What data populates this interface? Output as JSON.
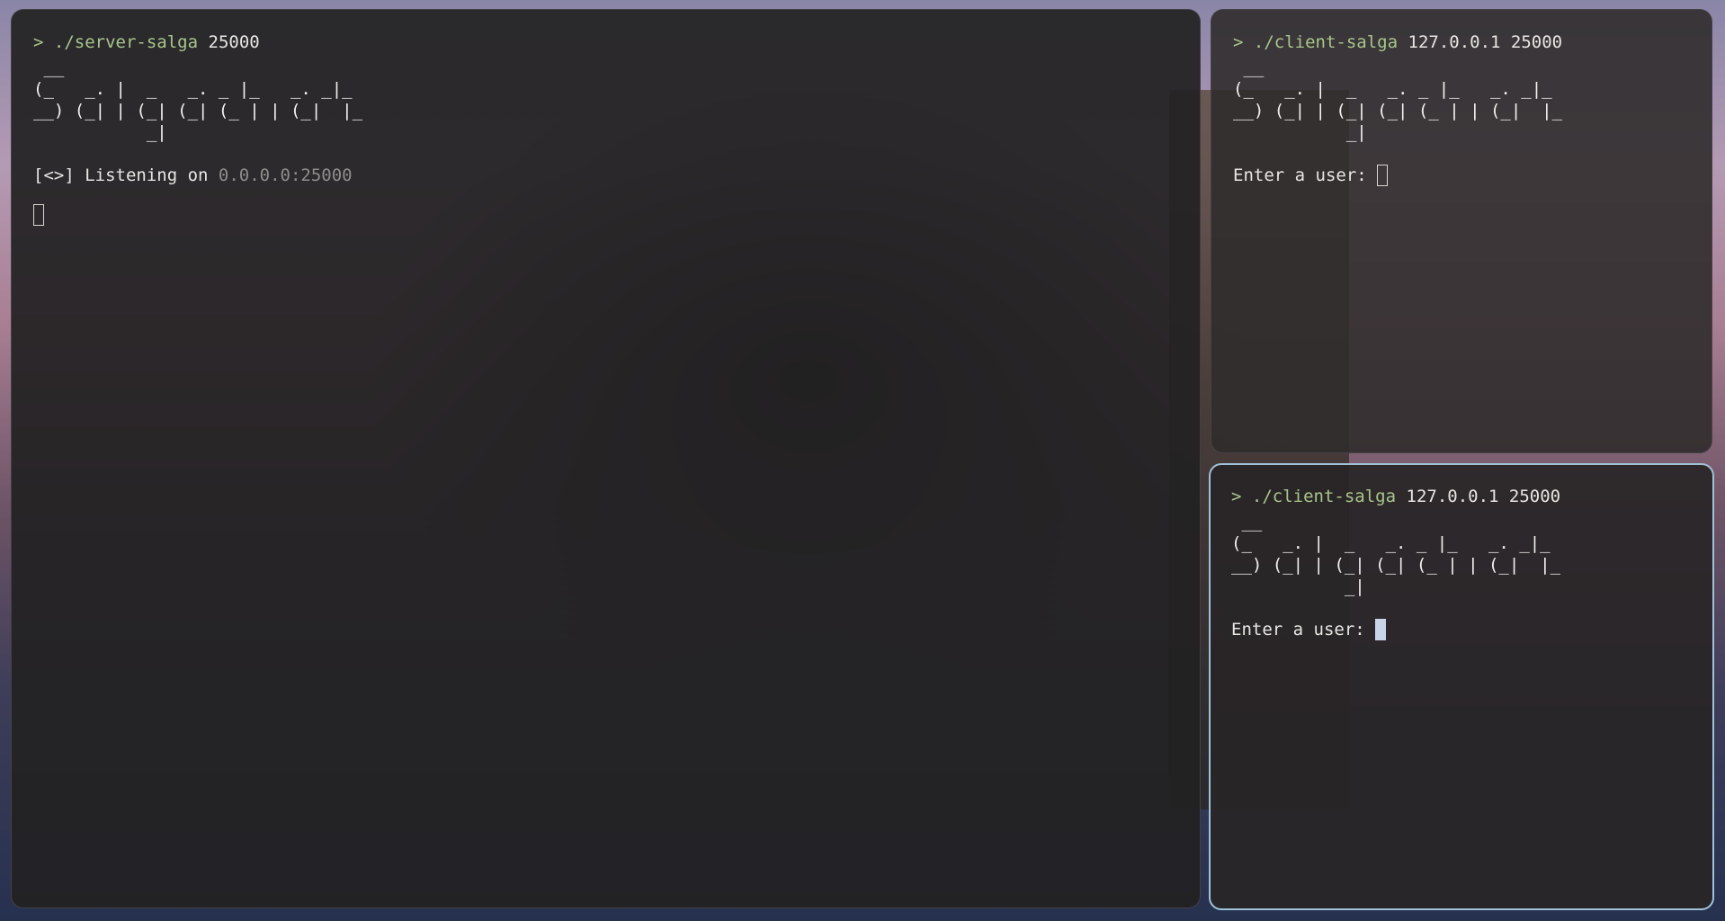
{
  "panes": {
    "server": {
      "prompt_symbol": ">",
      "command": "./server-salga",
      "args": "25000",
      "banner": " __\n(_   _. |  _   _. _ |_   _. _|_\n__) (_| | (_| (_| (_ | | (_|  |_\n           _|",
      "status_prefix": "[<>] Listening on ",
      "status_address": "0.0.0.0:25000"
    },
    "client_1": {
      "prompt_symbol": ">",
      "command": "./client-salga",
      "args": "127.0.0.1 25000",
      "banner": " __\n(_   _. |  _   _. _ |_   _. _|_\n__) (_| | (_| (_| (_ | | (_|  |_\n           _|",
      "input_prompt": "Enter a user: "
    },
    "client_2": {
      "prompt_symbol": ">",
      "command": "./client-salga",
      "args": "127.0.0.1 25000",
      "banner": " __\n(_   _. |  _   _. _ |_   _. _|_\n__) (_| | (_| (_| (_ | | (_|  |_\n           _|",
      "input_prompt": "Enter a user: "
    }
  },
  "colors": {
    "prompt_green": "#a7c68a",
    "active_border": "#9fc2d6",
    "dim_text": "#8f8c8b"
  }
}
